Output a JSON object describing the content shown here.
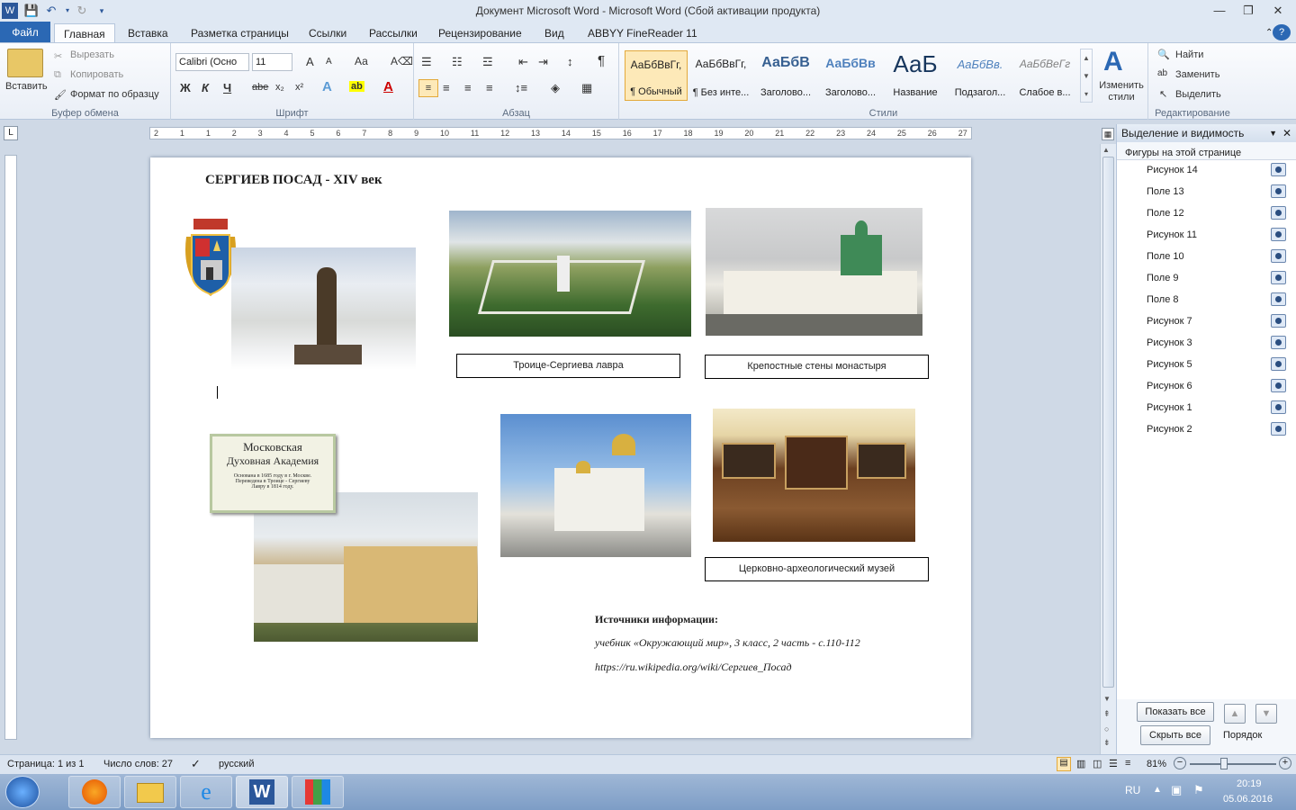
{
  "window": {
    "title": "Документ Microsoft Word  -  Microsoft Word (Сбой активации продукта)",
    "controls": {
      "minimize": "—",
      "restore": "❐",
      "close": "✕"
    }
  },
  "tabs": [
    "Файл",
    "Главная",
    "Вставка",
    "Разметка страницы",
    "Ссылки",
    "Рассылки",
    "Рецензирование",
    "Вид",
    "ABBYY FineReader 11"
  ],
  "ribbon": {
    "clipboard": {
      "label": "Буфер обмена",
      "paste": "Вставить",
      "cut": "Вырезать",
      "copy": "Копировать",
      "format_painter": "Формат по образцу"
    },
    "font": {
      "label": "Шрифт",
      "font_name": "Calibri (Осно",
      "font_size": "11",
      "bold": "Ж",
      "italic": "К",
      "underline": "Ч",
      "strike": "abe",
      "sub": "x₂",
      "sup": "x²",
      "grow": "A",
      "shrink": "A",
      "case": "Аа"
    },
    "paragraph": {
      "label": "Абзац",
      "pilcrow": "¶"
    },
    "styles": {
      "label": "Стили",
      "items": [
        {
          "sample": "АаБбВвГг,",
          "name": "¶ Обычный"
        },
        {
          "sample": "АаБбВвГг,",
          "name": "¶ Без инте..."
        },
        {
          "sample": "АаБбВ",
          "name": "Заголово..."
        },
        {
          "sample": "АаБбВв",
          "name": "Заголово..."
        },
        {
          "sample": "АаБ",
          "name": "Название"
        },
        {
          "sample": "АаБбВв.",
          "name": "Подзагол..."
        },
        {
          "sample": "АаБбВеГг",
          "name": "Слабое в..."
        }
      ],
      "change_styles": "Изменить стили"
    },
    "editing": {
      "label": "Редактирование",
      "find": "Найти",
      "replace": "Заменить",
      "select": "Выделить"
    }
  },
  "ruler": {
    "ticks": [
      "2",
      "1",
      "1",
      "2",
      "3",
      "4",
      "5",
      "6",
      "7",
      "8",
      "9",
      "10",
      "11",
      "12",
      "13",
      "14",
      "15",
      "16",
      "17",
      "18",
      "19",
      "20",
      "21",
      "22",
      "23",
      "24",
      "25",
      "26",
      "27"
    ]
  },
  "document": {
    "heading": "СЕРГИЕВ  ПОСАД  - XIV век",
    "captions": [
      "Троице-Сергиева лавра",
      "Крепостные стены монастыря",
      "Церковно-археологический музей"
    ],
    "plaque_text": [
      "Московская",
      "Духовная Академия",
      "Основана в 1685 году в г. Москве.",
      "Переведена в Троице - Сергиеву",
      "Лавру в 1814 году."
    ],
    "sources_title": "Источники информации:",
    "sources": [
      "учебник «Окружающий мир», 3 класс, 2 часть - с.110-112",
      "https://ru.wikipedia.org/wiki/Сергиев_Посад"
    ]
  },
  "selection_pane": {
    "title": "Выделение и видимость",
    "subtitle": "Фигуры на этой странице",
    "shapes": [
      "Рисунок 14",
      "Поле 13",
      "Поле 12",
      "Рисунок 11",
      "Поле 10",
      "Поле 9",
      "Поле 8",
      "Рисунок 7",
      "Рисунок 3",
      "Рисунок 5",
      "Рисунок 6",
      "Рисунок 1",
      "Рисунок 2"
    ],
    "show_all": "Показать все",
    "hide_all": "Скрыть все",
    "order": "Порядок"
  },
  "status": {
    "page": "Страница: 1 из 1",
    "words": "Число слов: 27",
    "language": "русский",
    "zoom": "81%"
  },
  "taskbar": {
    "lang": "RU",
    "time": "20:19",
    "date": "05.06.2016"
  }
}
